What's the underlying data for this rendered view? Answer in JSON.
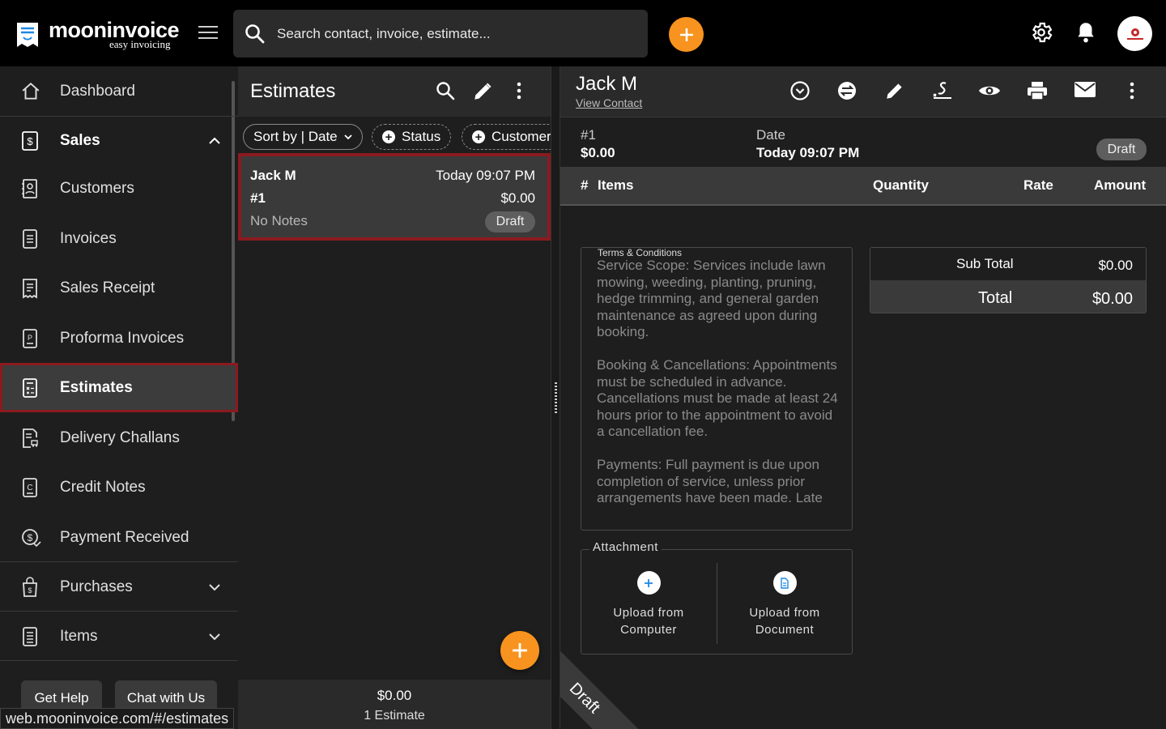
{
  "app": {
    "name": "mooninvoice",
    "tagline": "easy invoicing"
  },
  "search": {
    "placeholder": "Search contact, invoice, estimate..."
  },
  "colors": {
    "accent": "#f7931e",
    "highlight": "#8b1a1f"
  },
  "sidebar": {
    "items": [
      {
        "label": "Dashboard",
        "icon": "home-icon"
      },
      {
        "label": "Sales",
        "icon": "dollar-doc-icon"
      },
      {
        "label": "Customers",
        "icon": "contact-book-icon"
      },
      {
        "label": "Invoices",
        "icon": "invoice-icon"
      },
      {
        "label": "Sales Receipt",
        "icon": "receipt-icon"
      },
      {
        "label": "Proforma Invoices",
        "icon": "proforma-icon"
      },
      {
        "label": "Estimates",
        "icon": "calculator-icon"
      },
      {
        "label": "Delivery Challans",
        "icon": "delivery-icon"
      },
      {
        "label": "Credit Notes",
        "icon": "credit-note-icon"
      },
      {
        "label": "Payment Received",
        "icon": "payment-icon"
      },
      {
        "label": "Purchases",
        "icon": "bag-icon"
      },
      {
        "label": "Items",
        "icon": "list-icon"
      }
    ],
    "help_button": "Get Help",
    "chat_button": "Chat with Us"
  },
  "status_url": "web.mooninvoice.com/#/estimates",
  "list": {
    "title": "Estimates",
    "chips": {
      "sort": "Sort by | Date",
      "status": "Status",
      "customer": "Customer"
    },
    "card": {
      "name": "Jack M",
      "date": "Today 09:07 PM",
      "number": "#1",
      "amount": "$0.00",
      "notes": "No Notes",
      "status": "Draft"
    },
    "footer": {
      "total": "$0.00",
      "count": "1 Estimate"
    }
  },
  "detail": {
    "name": "Jack M",
    "view_contact": "View Contact",
    "number": "#1",
    "amount": "$0.00",
    "date_label": "Date",
    "date_value": "Today 09:07 PM",
    "status": "Draft",
    "columns": {
      "hash": "#",
      "items": "Items",
      "quantity": "Quantity",
      "rate": "Rate",
      "amount": "Amount"
    },
    "terms_label": "Terms & Conditions",
    "terms_text": "Service Scope: Services include lawn mowing, weeding, planting, pruning, hedge trimming, and general garden maintenance as agreed upon during booking.\n\nBooking & Cancellations: Appointments must be scheduled in advance. Cancellations must be made at least 24 hours prior to the appointment to avoid a cancellation fee.\n\nPayments: Full payment is due upon completion of service, unless prior arrangements have been made. Late",
    "sub_total_label": "Sub Total",
    "sub_total_value": "$0.00",
    "total_label": "Total",
    "total_value": "$0.00",
    "attachment_label": "Attachment",
    "upload_computer": "Upload from Computer",
    "upload_document": "Upload from Document",
    "ribbon": "Draft"
  }
}
